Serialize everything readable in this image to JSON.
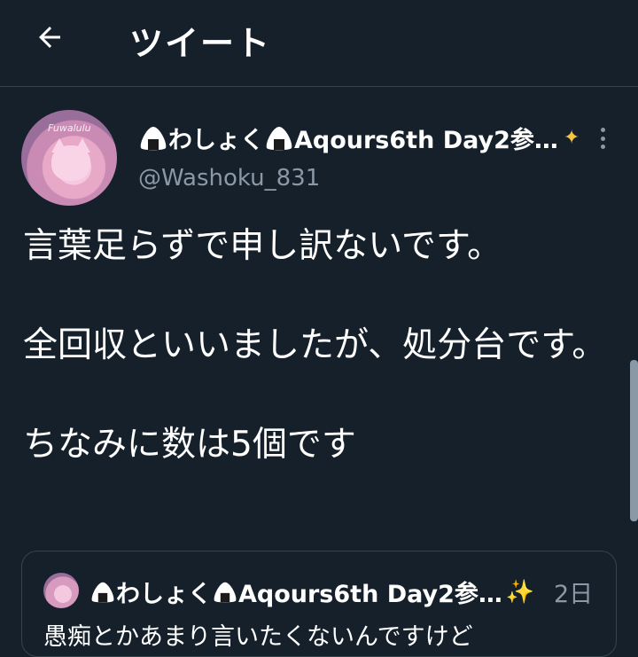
{
  "header": {
    "title": "ツイート"
  },
  "tweet": {
    "display_name": "わしょく",
    "display_name_suffix": "Aqours6th Day2参…",
    "handle": "@Washoku_831",
    "text": "言葉足らずで申し訳ないです。\n\n全回収といいましたが、処分台です。\n\nちなみに数は5個です",
    "avatar_text": "Fuwalulu"
  },
  "quoted_tweet": {
    "display_name": "わしょく",
    "display_name_suffix": "Aqours6th Day2参…",
    "sparkle": "✨",
    "time": "2日",
    "text": "愚痴とかあまり言いたくないんですけど"
  },
  "icons": [
    "back-arrow-icon",
    "onigiri-icon",
    "sparkle-icon",
    "more-vertical-icon"
  ],
  "colors": {
    "background": "#15202b",
    "secondary_text": "#8b98a5",
    "border": "#38444d"
  }
}
